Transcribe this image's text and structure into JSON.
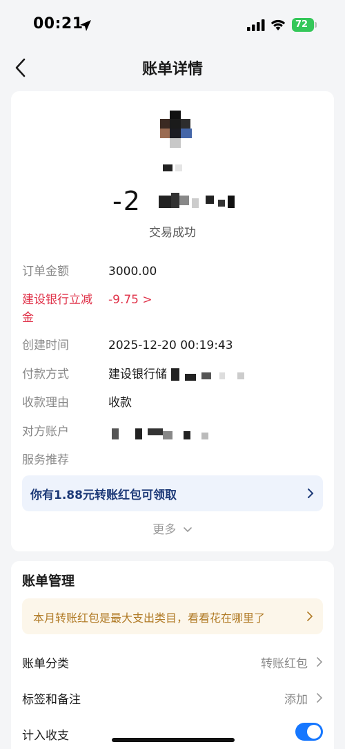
{
  "status_bar": {
    "time": "00:21",
    "battery": "72"
  },
  "nav": {
    "title": "账单详情"
  },
  "detail": {
    "amount": "-2",
    "status": "交易成功",
    "rows": [
      {
        "label": "订单金额",
        "value": "3000.00"
      },
      {
        "label": "建设银行立减金",
        "value": "-9.75 >"
      },
      {
        "label": "创建时间",
        "value": "2025-12-20 00:19:43"
      },
      {
        "label": "付款方式",
        "value": "建设银行储"
      },
      {
        "label": "收款理由",
        "value": "收款"
      },
      {
        "label": "对方账户",
        "value": ""
      },
      {
        "label": "服务推荐",
        "value": ""
      }
    ],
    "promo": "你有1.88元转账红包可领取",
    "more": "更多"
  },
  "manage": {
    "title": "账单管理",
    "tip": "本月转账红包是最大支出类目，看看花在哪里了",
    "rows": [
      {
        "label": "账单分类",
        "value": "转账红包"
      },
      {
        "label": "标签和备注",
        "value": "添加"
      },
      {
        "label": "计入收支",
        "value": ""
      }
    ]
  },
  "colors": {
    "accent": "#1677ff",
    "discount": "#e0334a",
    "promo_text": "#1d3a78",
    "tip_text": "#b07a25",
    "battery": "#34c759"
  },
  "icons": [
    "location-arrow-icon",
    "signal-icon",
    "wifi-icon",
    "battery-icon",
    "back-chevron-icon",
    "chevron-right-icon",
    "chevron-down-icon"
  ]
}
